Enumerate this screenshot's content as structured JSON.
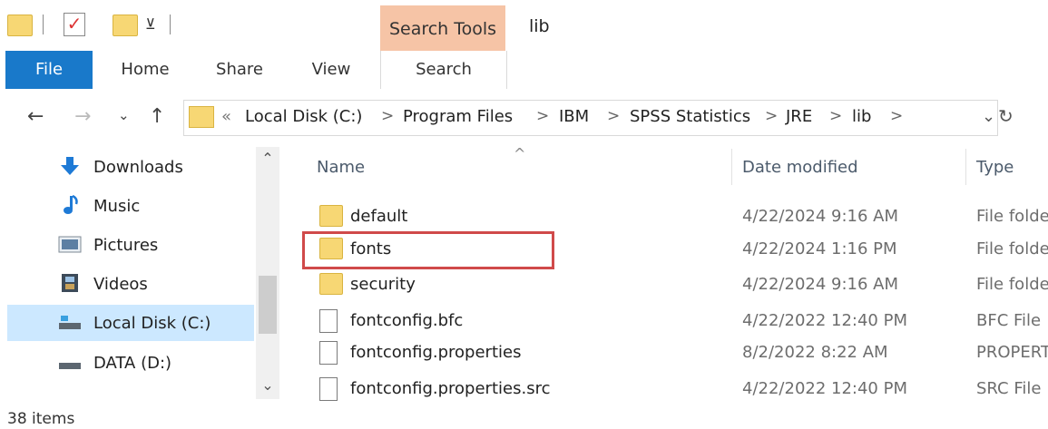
{
  "window": {
    "title": "lib"
  },
  "ribbon": {
    "contextual_tab": "Search Tools",
    "tabs": [
      "File",
      "Home",
      "Share",
      "View",
      "Search"
    ]
  },
  "address": {
    "prefix": "«",
    "crumbs": [
      "Local Disk (C:)",
      "Program Files",
      "IBM",
      "SPSS Statistics",
      "JRE",
      "lib"
    ],
    "separator": ">"
  },
  "sidebar": {
    "items": [
      {
        "label": "Downloads",
        "icon": "download-arrow-icon"
      },
      {
        "label": "Music",
        "icon": "music-note-icon"
      },
      {
        "label": "Pictures",
        "icon": "pictures-icon"
      },
      {
        "label": "Videos",
        "icon": "film-icon"
      },
      {
        "label": "Local Disk (C:)",
        "icon": "drive-icon",
        "selected": true
      },
      {
        "label": "DATA (D:)",
        "icon": "drive-icon"
      }
    ]
  },
  "filelist": {
    "columns": {
      "name": "Name",
      "date": "Date modified",
      "type": "Type"
    },
    "rows": [
      {
        "name": "default",
        "date": "4/22/2024 9:16 AM",
        "type": "File folder",
        "kind": "folder"
      },
      {
        "name": "fonts",
        "date": "4/22/2024 1:16 PM",
        "type": "File folder",
        "kind": "folder",
        "highlighted": true
      },
      {
        "name": "security",
        "date": "4/22/2024 9:16 AM",
        "type": "File folder",
        "kind": "folder"
      },
      {
        "name": "fontconfig.bfc",
        "date": "4/22/2022 12:40 PM",
        "type": "BFC File",
        "kind": "file"
      },
      {
        "name": "fontconfig.properties",
        "date": "8/2/2022 8:22 AM",
        "type": "PROPERTIES",
        "kind": "file"
      },
      {
        "name": "fontconfig.properties.src",
        "date": "4/22/2022 12:40 PM",
        "type": "SRC File",
        "kind": "file"
      }
    ]
  },
  "status": {
    "item_count": "38 items"
  },
  "colors": {
    "accent": "#1979ca",
    "search_tools": "#f6c4a6",
    "selection": "#cce8ff",
    "highlight_box": "#d04a4a"
  }
}
